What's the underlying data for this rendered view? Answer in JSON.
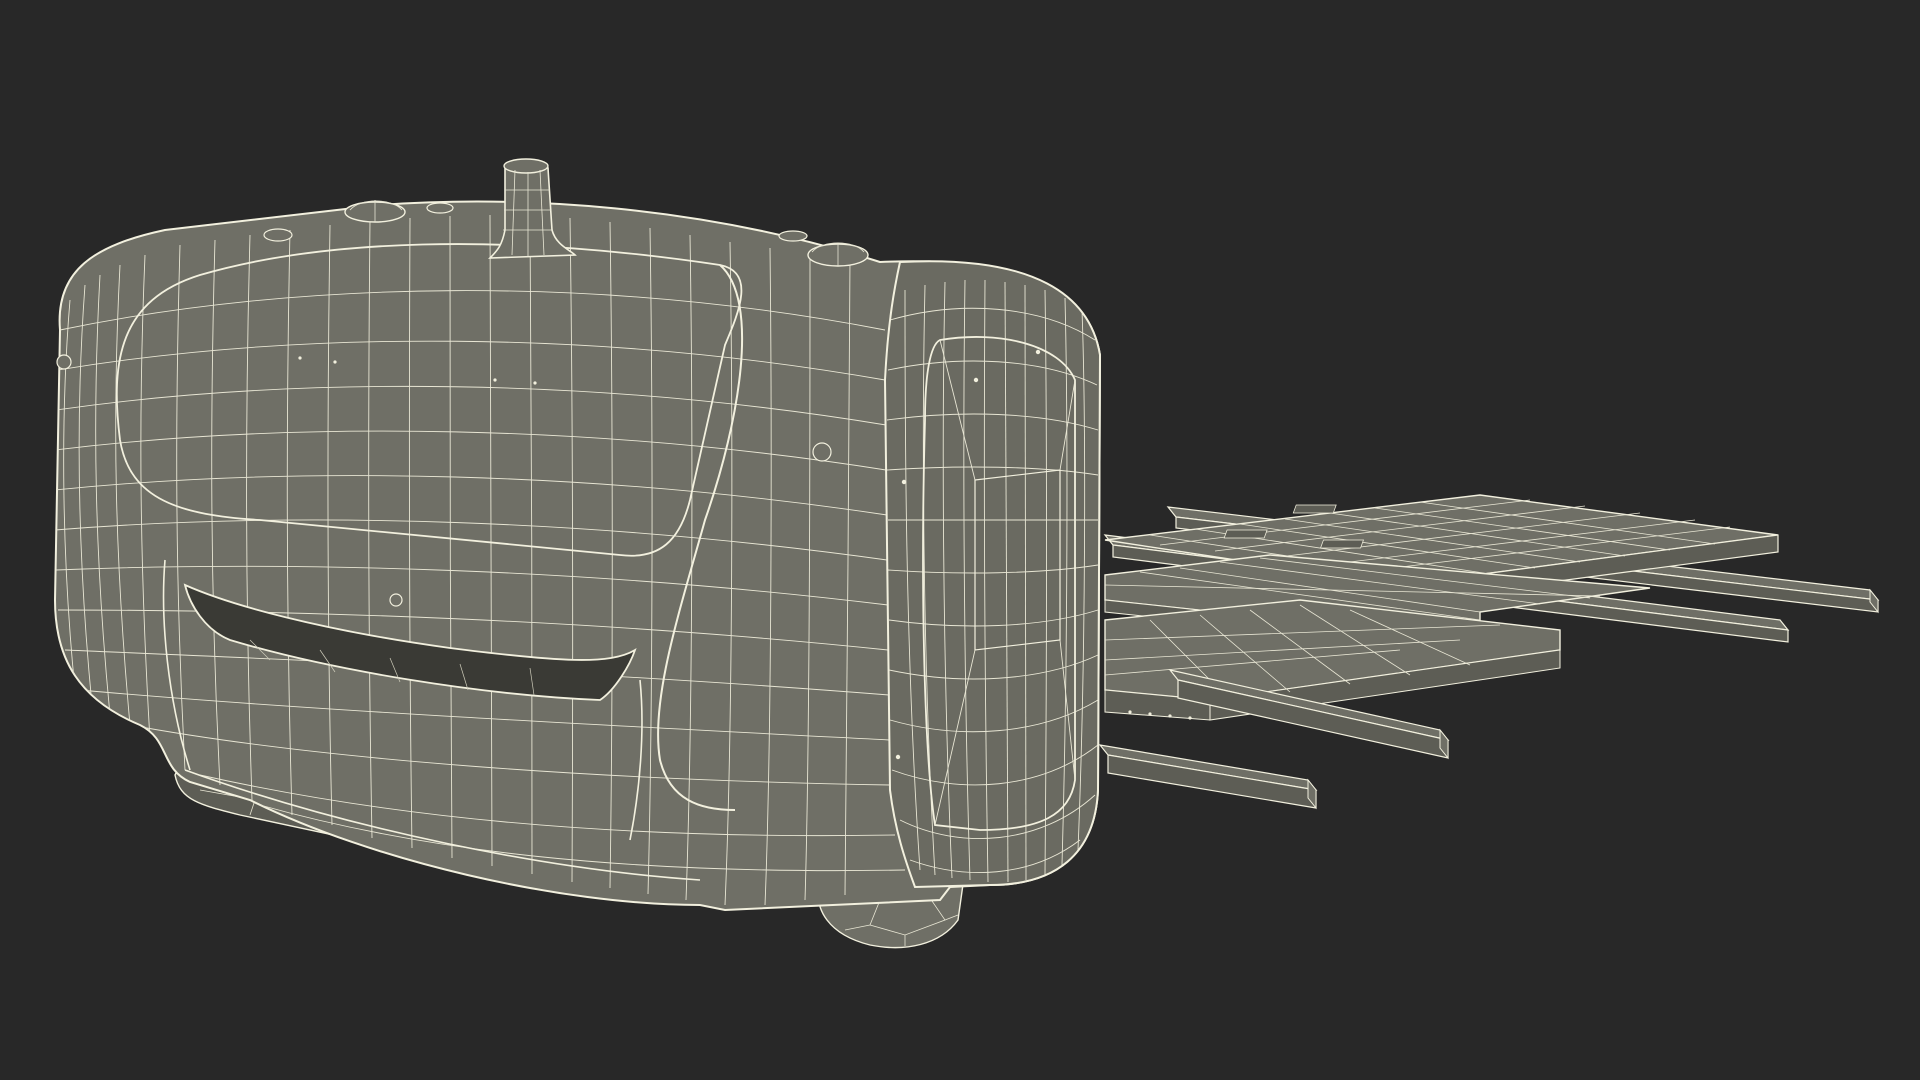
{
  "scene": {
    "subject": "robot-vehicle-wireframe-icon",
    "render_style": "wireframe",
    "colors": {
      "background": "#282828",
      "body_fill": "#6f6f66",
      "body_fill_dark": "#5d5d55",
      "shadow_fill": "#3a3a35",
      "wire": "#f2f0de",
      "wire_dense": "#dcdac8"
    }
  }
}
